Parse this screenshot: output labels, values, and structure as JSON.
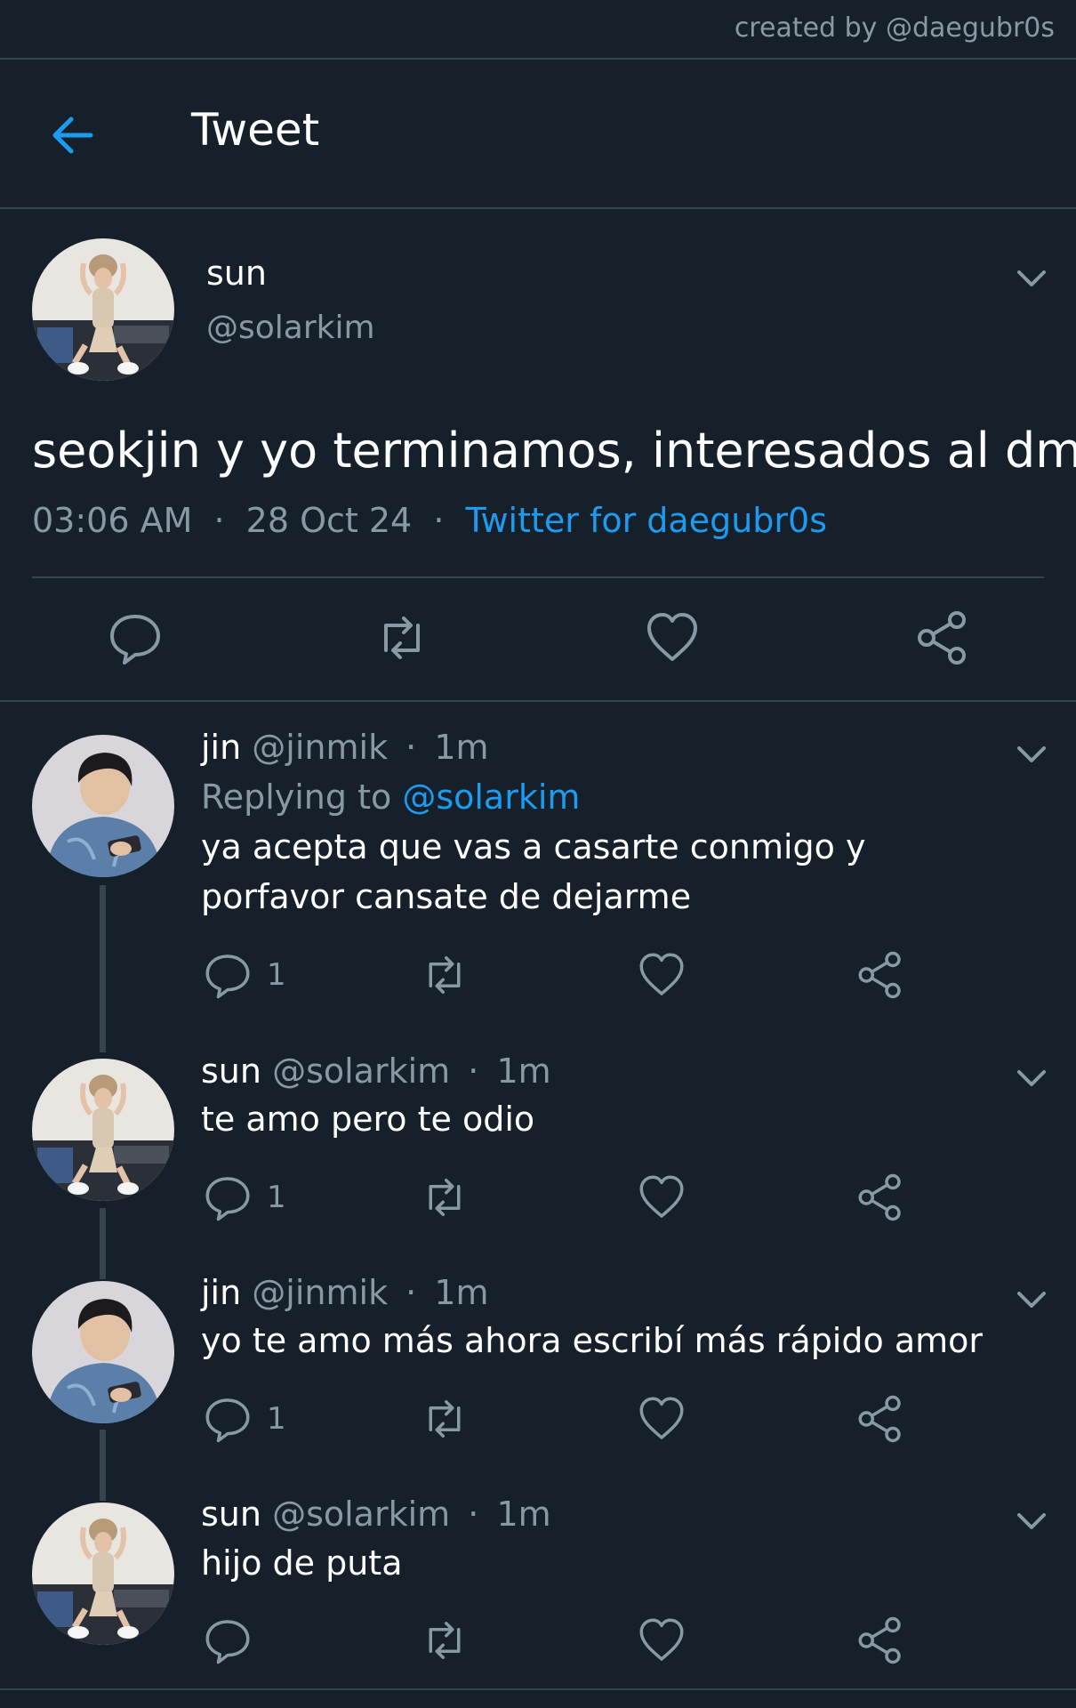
{
  "watermark": "created by @daegubr0s",
  "header": {
    "title": "Tweet",
    "back_icon": "arrow-left-icon"
  },
  "colors": {
    "background": "#15202b",
    "accent": "#1d9bf0",
    "muted": "#8899a6",
    "divider": "#38444d"
  },
  "main_tweet": {
    "name": "sun",
    "handle": "@solarkim",
    "text": "seokjin y yo terminamos, interesados al dm",
    "time": "03:06 AM",
    "date": "28 Oct 24",
    "separator": "·",
    "source": "Twitter for daegubr0s"
  },
  "replies": [
    {
      "name": "jin",
      "handle": "@jinmik",
      "time": "1m",
      "replying_label": "Replying to",
      "replying_to": "@solarkim",
      "text": "ya acepta que vas a casarte conmigo y porfavor cansate de dejarme",
      "reply_count": "1"
    },
    {
      "name": "sun",
      "handle": "@solarkim",
      "time": "1m",
      "text": "te amo pero te odio",
      "reply_count": "1"
    },
    {
      "name": "jin",
      "handle": "@jinmik",
      "time": "1m",
      "text": "yo te amo más ahora escribí más rápido amor",
      "reply_count": "1"
    },
    {
      "name": "sun",
      "handle": "@solarkim",
      "time": "1m",
      "text": "hijo de puta",
      "reply_count": ""
    }
  ]
}
